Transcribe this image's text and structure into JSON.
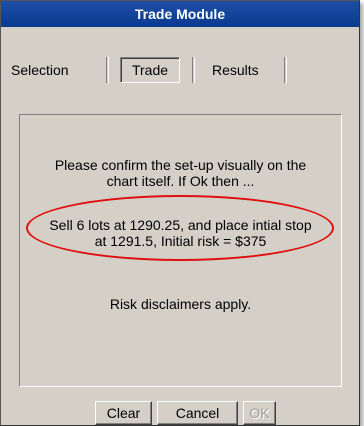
{
  "window": {
    "title": "Trade Module"
  },
  "tabs": [
    {
      "label": "Selection"
    },
    {
      "label": "Trade"
    },
    {
      "label": "Results"
    }
  ],
  "message": {
    "confirm_line1": "Please confirm the set-up visually on the",
    "confirm_line2": "chart itself. If Ok then ...",
    "trade_line1": "Sell 6 lots at 1290.25, and place intial stop",
    "trade_line2": "at 1291.5, Initial risk = $375",
    "disclaimer": "Risk disclaimers apply."
  },
  "buttons": {
    "clear": "Clear",
    "cancel": "Cancel",
    "ok": "OK"
  }
}
